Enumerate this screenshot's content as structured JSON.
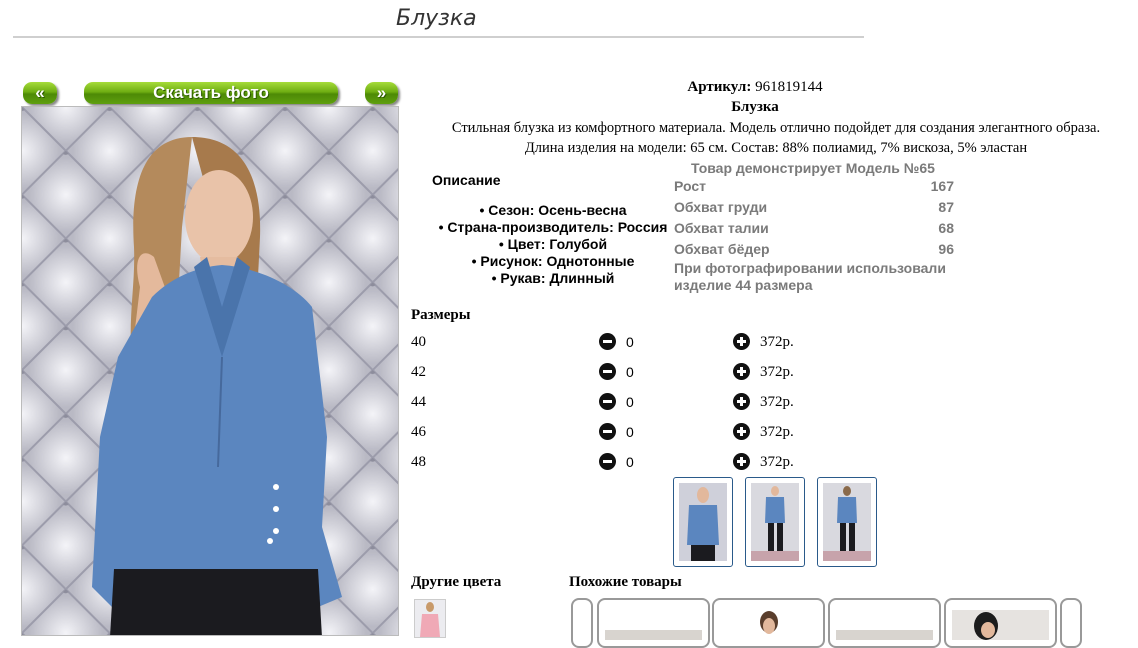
{
  "page": {
    "title": "Блузка"
  },
  "buttons": {
    "prev": "«",
    "download": "Скачать фото",
    "next": "»"
  },
  "product": {
    "artikul_label": "Артикул:",
    "artikul_value": "961819144",
    "name": "Блузка",
    "description_line1": "Стильная блузка из комфортного материала. Модель отлично подойдет для создания элегантного образа.",
    "description_line2": "Длина изделия на модели: 65 см. Состав: 88% полиамид, 7% вискоза, 5% эластан"
  },
  "details": {
    "heading": "Описание",
    "attributes": [
      "• Сезон: Осень-весна",
      "• Страна-производитель: Россия",
      "• Цвет: Голубой",
      "• Рисунок: Однотонные",
      "• Рукав: Длинный"
    ]
  },
  "model": {
    "title": "Товар демонстрирует Модель №65",
    "rows": [
      {
        "label": "Рост",
        "value": "167"
      },
      {
        "label": "Обхват груди",
        "value": "87"
      },
      {
        "label": "Обхват талии",
        "value": "68"
      },
      {
        "label": "Обхват бёдер",
        "value": "96"
      }
    ],
    "note_line1": "При фотографировании использовали",
    "note_line2": "изделие 44 размера"
  },
  "sizes": {
    "heading": "Размеры",
    "rows": [
      {
        "size": "40",
        "qty": "0",
        "price": "372р."
      },
      {
        "size": "42",
        "qty": "0",
        "price": "372р."
      },
      {
        "size": "44",
        "qty": "0",
        "price": "372р."
      },
      {
        "size": "46",
        "qty": "0",
        "price": "372р."
      },
      {
        "size": "48",
        "qty": "0",
        "price": "372р."
      }
    ]
  },
  "sections": {
    "other_colors": "Другие цвета",
    "similar": "Похожие товары"
  },
  "colors": {
    "accent_green": "#6fae12",
    "blouse_blue": "#5b86bf",
    "thumb_border": "#2a5a8a"
  }
}
